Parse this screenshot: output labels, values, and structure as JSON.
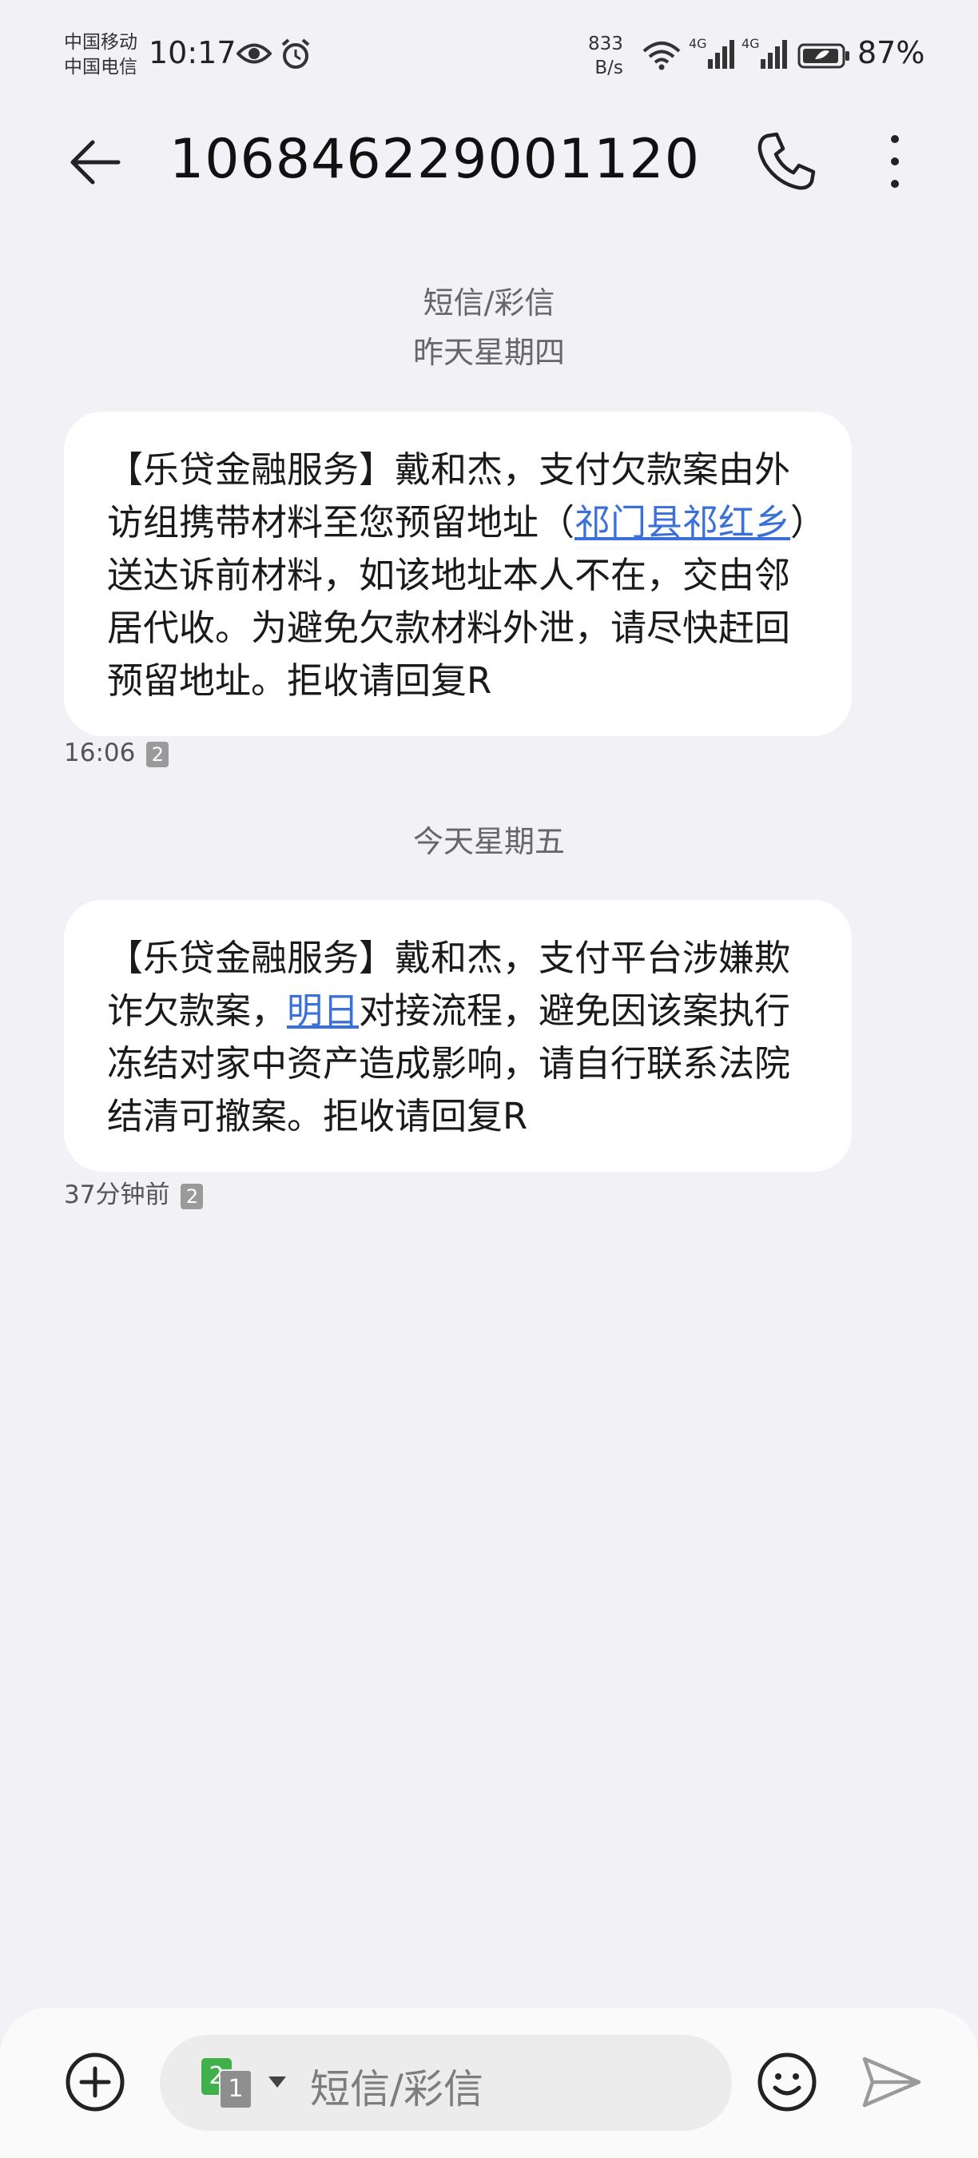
{
  "status_bar": {
    "carrier_1": "中国移动",
    "carrier_2": "中国电信",
    "time": "10:17",
    "net_speed_value": "833",
    "net_speed_unit": "B/s",
    "signal_label_1": "4G",
    "signal_label_2": "4G",
    "battery": "87%"
  },
  "header": {
    "title": "106846229001120"
  },
  "thread": {
    "channel_label": "短信/彩信",
    "day_1": "昨天星期四",
    "day_2": "今天星期五"
  },
  "messages": [
    {
      "text_before": "【乐贷金融服务】戴和杰，支付欠款案由外访组携带材料至您预留地址（",
      "link": "祁门县祁红乡",
      "text_after": "）送达诉前材料，如该地址本人不在，交由邻居代收。为避免欠款材料外泄，请尽快赶回预留地址。拒收请回复R",
      "time": "16:06",
      "sim": "2"
    },
    {
      "text_before": "【乐贷金融服务】戴和杰，支付平台涉嫌欺诈欠款案，",
      "link": "明日",
      "text_after": "对接流程，避免因该案执行冻结对家中资产造成影响，请自行联系法院结清可撤案。拒收请回复R",
      "time": "37分钟前",
      "sim": "2"
    }
  ],
  "composer": {
    "placeholder": "短信/彩信",
    "sim_primary": "2",
    "sim_secondary": "1"
  },
  "colors": {
    "background": "#f1f1f6",
    "bubble": "#ffffff",
    "link": "#3b6fd9",
    "sim_green": "#3fb04a"
  }
}
